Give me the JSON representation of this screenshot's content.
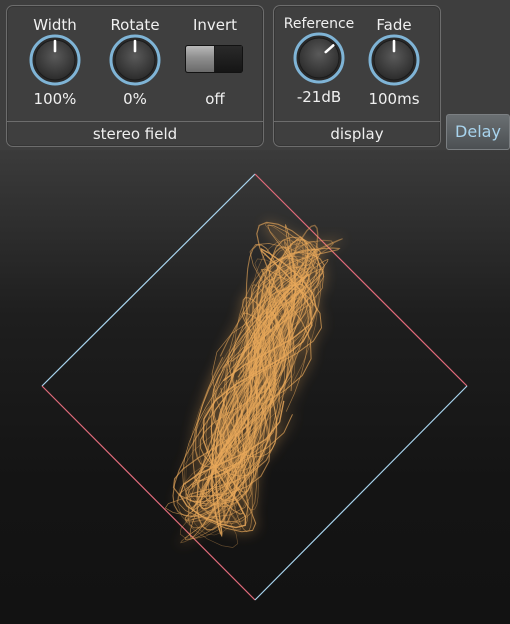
{
  "stereo_field": {
    "title": "stereo field",
    "width": {
      "label": "Width",
      "value": "100%",
      "level": 0.5
    },
    "rotate": {
      "label": "Rotate",
      "value": "0%",
      "level": 0.5
    },
    "invert": {
      "label": "Invert",
      "value": "off",
      "state": false
    }
  },
  "display": {
    "title": "display",
    "reference": {
      "label": "Reference",
      "value": "-21dB",
      "level": 0.68
    },
    "fade": {
      "label": "Fade",
      "value": "100ms",
      "level": 0.5
    }
  },
  "delay_button": {
    "label": "Delay",
    "color": "#a8d4ee"
  },
  "colors": {
    "knob_ring": "#7fb4d6",
    "diamond_red": "#e06a7a",
    "diamond_blue": "#a8d4ee",
    "trace": "#e8a85a"
  }
}
